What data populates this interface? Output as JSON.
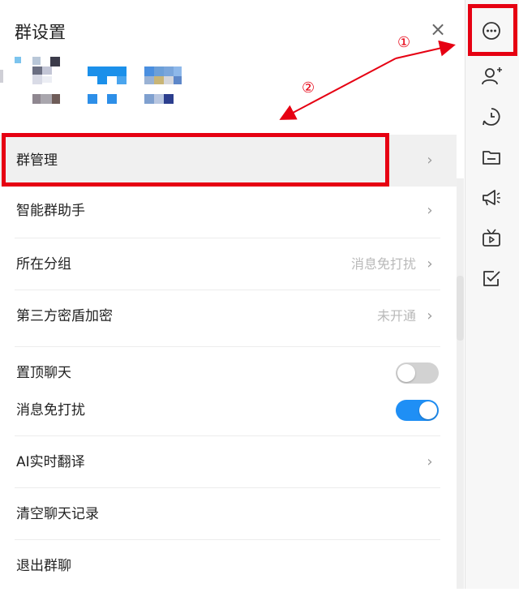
{
  "panel": {
    "title": "群设置",
    "close_glyph": "×"
  },
  "menu": {
    "group_manage": {
      "label": "群管理",
      "chevron": "›"
    },
    "smart_assistant": {
      "label": "智能群助手",
      "chevron": "›"
    },
    "group_category": {
      "label": "所在分组",
      "value": "消息免打扰",
      "chevron": "›"
    },
    "encryption": {
      "label": "第三方密盾加密",
      "value": "未开通",
      "chevron": "›"
    },
    "pin_chat": {
      "label": "置顶聊天",
      "toggle_on": false
    },
    "mute": {
      "label": "消息免打扰",
      "toggle_on": true
    },
    "ai_translate": {
      "label": "AI实时翻译",
      "chevron": "›"
    },
    "clear_history": {
      "label": "清空聊天记录"
    },
    "leave_group": {
      "label": "退出群聊"
    }
  },
  "annotations": {
    "step1": "①",
    "step2": "②",
    "highlight_color": "#e60012"
  },
  "sidebar_icons": [
    "more-icon",
    "add-member-icon",
    "history-icon",
    "folder-icon",
    "announcement-icon",
    "video-icon",
    "checkbox-icon"
  ],
  "colors": {
    "toggle_on": "#1f8ff5",
    "toggle_off": "#d2d2d2",
    "value_text": "#b9b9b9"
  }
}
